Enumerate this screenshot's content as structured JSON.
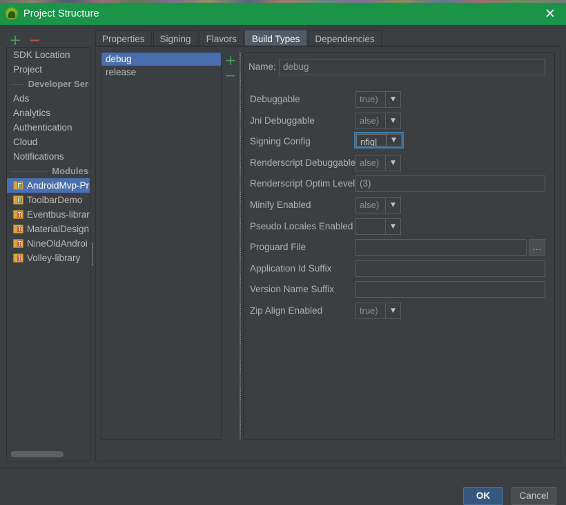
{
  "window": {
    "title": "Project Structure",
    "icon": "android-studio-icon",
    "close_label": "✕",
    "titlebar_color": "#1b9447"
  },
  "sidebar": {
    "toolbar": {
      "add_label": "+",
      "remove_label": "−"
    },
    "items": [
      {
        "label": "SDK Location",
        "type": "item",
        "selected": false
      },
      {
        "label": "Project",
        "type": "item",
        "selected": false
      },
      {
        "label": "Developer Ser",
        "type": "separator"
      },
      {
        "label": "Ads",
        "type": "item",
        "selected": false
      },
      {
        "label": "Analytics",
        "type": "item",
        "selected": false
      },
      {
        "label": "Authentication",
        "type": "item",
        "selected": false
      },
      {
        "label": "Cloud",
        "type": "item",
        "selected": false
      },
      {
        "label": "Notifications",
        "type": "item",
        "selected": false
      },
      {
        "label": "Modules",
        "type": "separator"
      },
      {
        "label": "AndroidMvp-Pr",
        "type": "module",
        "icon": "module-app-icon",
        "selected": true
      },
      {
        "label": "ToolbarDemo",
        "type": "module",
        "icon": "module-app-icon",
        "selected": false
      },
      {
        "label": "Eventbus-librar",
        "type": "module",
        "icon": "module-library-icon",
        "selected": false
      },
      {
        "label": "MaterialDesign",
        "type": "module",
        "icon": "module-library-icon",
        "selected": false
      },
      {
        "label": "NineOldAndroi",
        "type": "module",
        "icon": "module-library-icon",
        "selected": false
      },
      {
        "label": "Volley-library",
        "type": "module",
        "icon": "module-library-icon",
        "selected": false
      }
    ]
  },
  "tabs": [
    {
      "label": "Properties",
      "active": false
    },
    {
      "label": "Signing",
      "active": false
    },
    {
      "label": "Flavors",
      "active": false
    },
    {
      "label": "Build Types",
      "active": true
    },
    {
      "label": "Dependencies",
      "active": false
    }
  ],
  "build_types": {
    "items": [
      {
        "label": "debug",
        "selected": true
      },
      {
        "label": "release",
        "selected": false
      }
    ],
    "add_label": "+",
    "remove_label": "−"
  },
  "form": {
    "name_label": "Name:",
    "name_value": "debug",
    "rows": [
      {
        "label": "Debuggable",
        "kind": "combo",
        "value": "true)",
        "focused": false
      },
      {
        "label": "Jni Debuggable",
        "kind": "combo",
        "value": "alse)",
        "focused": false
      },
      {
        "label": "Signing Config",
        "kind": "combo",
        "value": "nfig|",
        "focused": true
      },
      {
        "label": "Renderscript Debuggable",
        "kind": "combo",
        "value": "alse)",
        "focused": false
      },
      {
        "label": "Renderscript Optim Level",
        "kind": "text",
        "value": "(3)"
      },
      {
        "label": "Minify Enabled",
        "kind": "combo",
        "value": "alse)",
        "focused": false
      },
      {
        "label": "Pseudo Locales Enabled",
        "kind": "combo",
        "value": "",
        "focused": false
      },
      {
        "label": "Proguard File",
        "kind": "text-browse",
        "value": "",
        "browse_label": "…"
      },
      {
        "label": "Application Id Suffix",
        "kind": "text",
        "value": ""
      },
      {
        "label": "Version Name Suffix",
        "kind": "text",
        "value": ""
      },
      {
        "label": "Zip Align Enabled",
        "kind": "combo",
        "value": "true)",
        "focused": false
      }
    ],
    "combo_arrow": "▼"
  },
  "footer": {
    "ok_label": "OK",
    "cancel_label": "Cancel"
  },
  "colors": {
    "accent_selection": "#4b6eaf",
    "title_green": "#1b9447",
    "ok_blue": "#365880",
    "add_green": "#499c54",
    "remove_red": "#c75450",
    "focus_blue": "#3c7fb1"
  }
}
